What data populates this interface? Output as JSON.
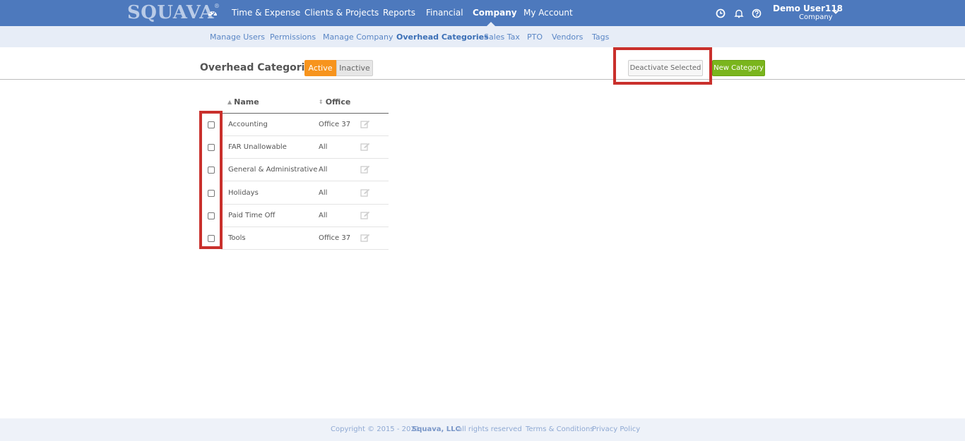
{
  "header": {
    "logo": "SQUAVA",
    "logo_mark": "®",
    "nav": [
      {
        "label": "Time & Expense"
      },
      {
        "label": "Clients & Projects"
      },
      {
        "label": "Reports"
      },
      {
        "label": "Financial"
      },
      {
        "label": "Company"
      },
      {
        "label": "My Account"
      }
    ],
    "active_nav": "Company",
    "user": {
      "name": "Demo User118",
      "role": "Company"
    },
    "icons": [
      "dashboard-icon",
      "clock-icon",
      "bell-icon",
      "help-icon",
      "chevron-down-icon"
    ]
  },
  "subnav": {
    "items": [
      {
        "label": "Manage Users"
      },
      {
        "label": "Permissions"
      },
      {
        "label": "Manage Company"
      },
      {
        "label": "Overhead Categories"
      },
      {
        "label": "Sales Tax"
      },
      {
        "label": "PTO"
      },
      {
        "label": "Vendors"
      },
      {
        "label": "Tags"
      }
    ],
    "active": "Overhead Categories"
  },
  "page": {
    "title": "Overhead Categories",
    "toggle": {
      "active_label": "Active",
      "inactive_label": "Inactive",
      "selected": "Active"
    },
    "deactivate_button": "Deactivate Selected",
    "new_button": "New Category"
  },
  "table": {
    "columns": [
      {
        "label": "Name",
        "sort_icon": "sort-asc-icon"
      },
      {
        "label": "Office",
        "sort_icon": "sort-both-icon"
      }
    ],
    "rows": [
      {
        "name": "Accounting",
        "office": "Office 37"
      },
      {
        "name": "FAR Unallowable",
        "office": "All"
      },
      {
        "name": "General & Administrative",
        "office": "All"
      },
      {
        "name": "Holidays",
        "office": "All"
      },
      {
        "name": "Paid Time Off",
        "office": "All"
      },
      {
        "name": "Tools",
        "office": "Office 37"
      }
    ]
  },
  "footer": {
    "copyright": "Copyright © 2015 - 2021",
    "company": "Squava, LLC",
    "rights": "all rights reserved",
    "terms": "Terms & Conditions",
    "privacy": "Privacy Policy"
  },
  "colors": {
    "topbar": "#4d79bd",
    "subbar": "#e7edf7",
    "active_toggle": "#f7941d",
    "new_button": "#7ab51d",
    "highlight": "#c9302c"
  }
}
